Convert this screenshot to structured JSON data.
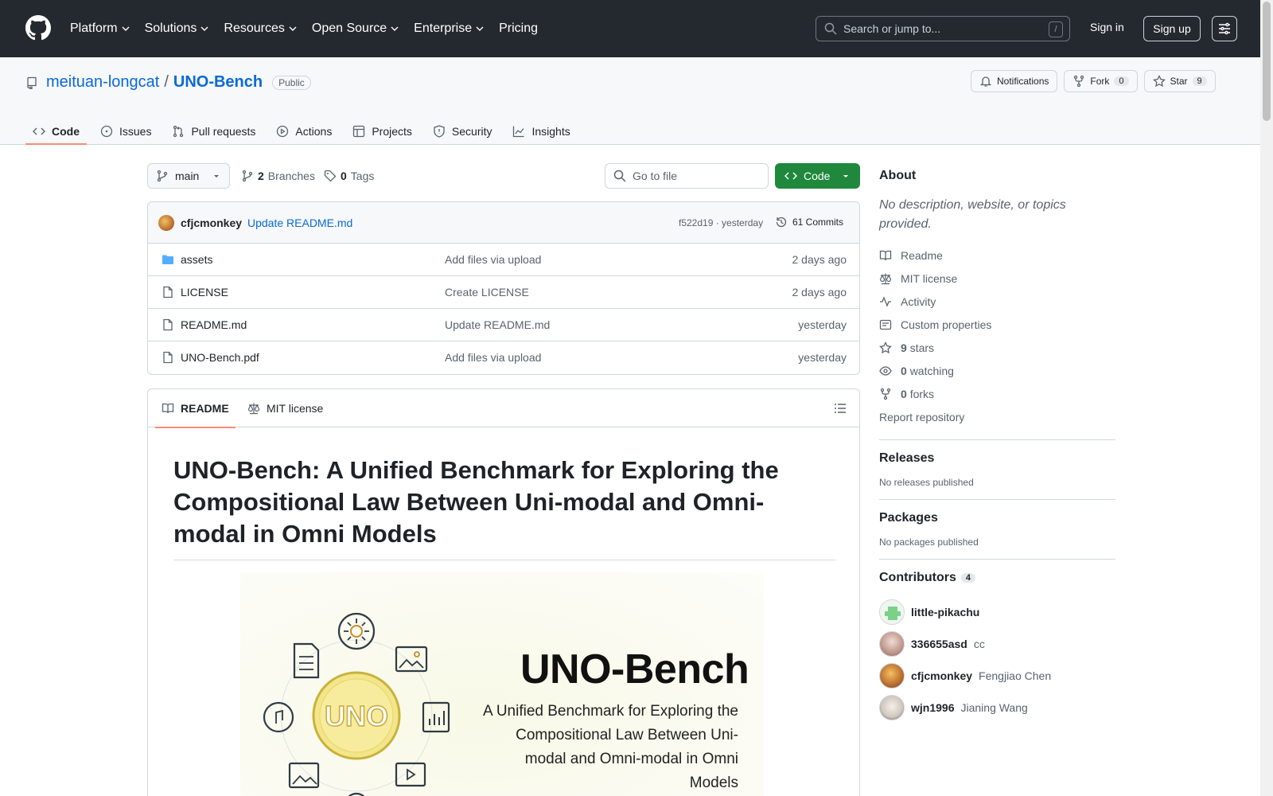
{
  "topnav": {
    "items": [
      "Platform",
      "Solutions",
      "Resources",
      "Open Source",
      "Enterprise",
      "Pricing"
    ],
    "search_placeholder": "Search or jump to...",
    "search_key": "/",
    "signin": "Sign in",
    "signup": "Sign up"
  },
  "repo": {
    "owner": "meituan-longcat",
    "separator": "/",
    "name": "UNO-Bench",
    "visibility": "Public",
    "notifications_label": "Notifications",
    "fork_label": "Fork",
    "fork_count": "0",
    "star_label": "Star",
    "star_count": "9"
  },
  "tabs": [
    "Code",
    "Issues",
    "Pull requests",
    "Actions",
    "Projects",
    "Security",
    "Insights"
  ],
  "branchbar": {
    "branch": "main",
    "branches_count": "2",
    "branches_label": "Branches",
    "tags_count": "0",
    "tags_label": "Tags",
    "goto_placeholder": "Go to file",
    "code_button": "Code"
  },
  "latest_commit": {
    "author": "cfjcmonkey",
    "message": "Update README.md",
    "hash_time": "f522d19 · yesterday",
    "commits_label": "61 Commits"
  },
  "files": [
    {
      "name": "assets",
      "type": "folder",
      "message": "Add files via upload",
      "time": "2 days ago"
    },
    {
      "name": "LICENSE",
      "type": "file",
      "message": "Create LICENSE",
      "time": "2 days ago"
    },
    {
      "name": "README.md",
      "type": "file",
      "message": "Update README.md",
      "time": "yesterday"
    },
    {
      "name": "UNO-Bench.pdf",
      "type": "file",
      "message": "Add files via upload",
      "time": "yesterday"
    }
  ],
  "readme": {
    "tab_readme": "README",
    "tab_license": "MIT license",
    "title": "UNO-Bench: A Unified Benchmark for Exploring the Compositional Law Between Uni-modal and Omni-modal in Omni Models",
    "hero_logo_text": "UNO",
    "hero_title": "UNO-Bench",
    "hero_subtitle": "A Unified Benchmark for Exploring the Compositional Law Between Uni-modal and Omni-modal in Omni Models"
  },
  "sidebar": {
    "about_heading": "About",
    "about_desc": "No description, website, or topics provided.",
    "links": {
      "readme": "Readme",
      "license": "MIT license",
      "activity": "Activity",
      "custom_properties": "Custom properties",
      "stars_num": "9",
      "stars_label": "stars",
      "watching_num": "0",
      "watching_label": "watching",
      "forks_num": "0",
      "forks_label": "forks",
      "report": "Report repository"
    },
    "releases_heading": "Releases",
    "releases_text": "No releases published",
    "packages_heading": "Packages",
    "packages_text": "No packages published",
    "contributors_heading": "Contributors",
    "contributors_count": "4",
    "contributors": [
      {
        "login": "little-pikachu",
        "name": ""
      },
      {
        "login": "336655asd",
        "name": "cc"
      },
      {
        "login": "cfjcmonkey",
        "name": "Fengjiao Chen"
      },
      {
        "login": "wjn1996",
        "name": "Jianing Wang"
      }
    ]
  },
  "colors": {
    "header_bg": "#24292f",
    "accent": "#0969da",
    "code_button": "#1f883d",
    "tab_underline": "#fd8c73"
  }
}
